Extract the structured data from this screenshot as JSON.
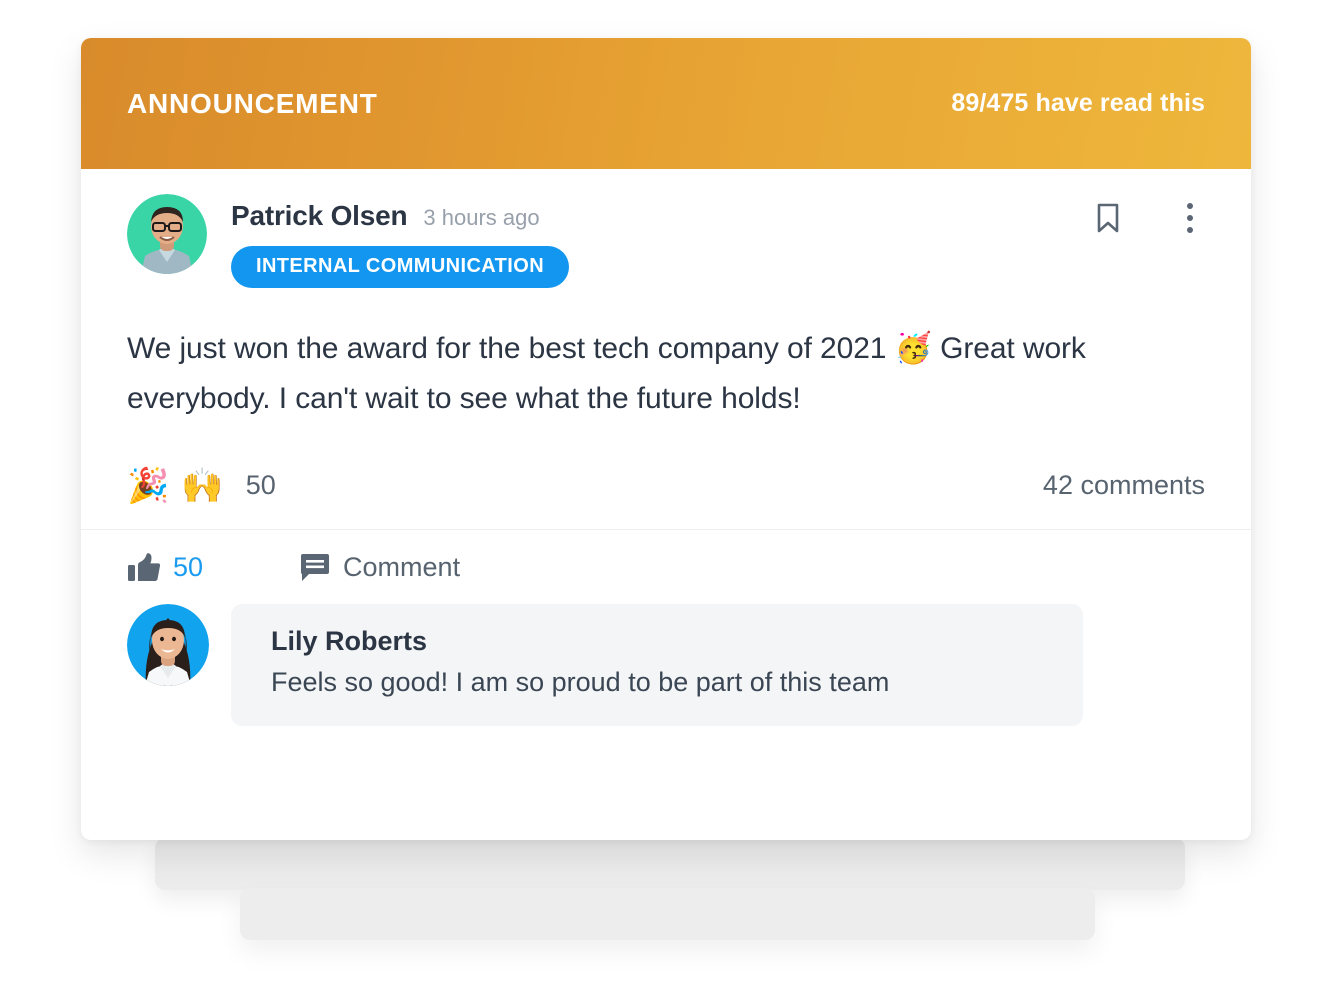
{
  "card": {
    "header": {
      "title": "ANNOUNCEMENT",
      "read_status": "89/475 have read this",
      "gradient_start": "#d98b2b",
      "gradient_end": "#eeb73c"
    },
    "post": {
      "author_name": "Patrick Olsen",
      "timestamp": "3 hours ago",
      "badge_label": "INTERNAL COMMUNICATION",
      "badge_color": "#1296f0",
      "avatar_icon": "user-avatar-patrick",
      "avatar_bg": "#3ad5a7",
      "body_part1": " We just won the award for the best tech company of 2021 ",
      "body_emoji": "🥳",
      "body_part2": " Great work everybody. I can't wait to see what the future holds!",
      "bookmark_icon": "bookmark-icon",
      "more_icon": "more-vertical-icon"
    },
    "reactions": {
      "emoji_1": "🎉",
      "emoji_1_name": "party-popper-emoji",
      "emoji_2": "🙌",
      "emoji_2_name": "raising-hands-emoji",
      "count": "50",
      "comments_count": "42 comments"
    },
    "actions": {
      "like_icon": "thumbs-up-icon",
      "like_count": "50",
      "like_count_color": "#1a9bf0",
      "comment_icon": "comment-bubble-icon",
      "comment_label": "Comment"
    },
    "comment": {
      "author_name": "Lily Roberts",
      "text": "Feels so good! I am so proud to be part of this team",
      "avatar_icon": "user-avatar-lily",
      "avatar_bg": "#12a3ee",
      "bubble_bg": "#f4f5f7"
    }
  }
}
